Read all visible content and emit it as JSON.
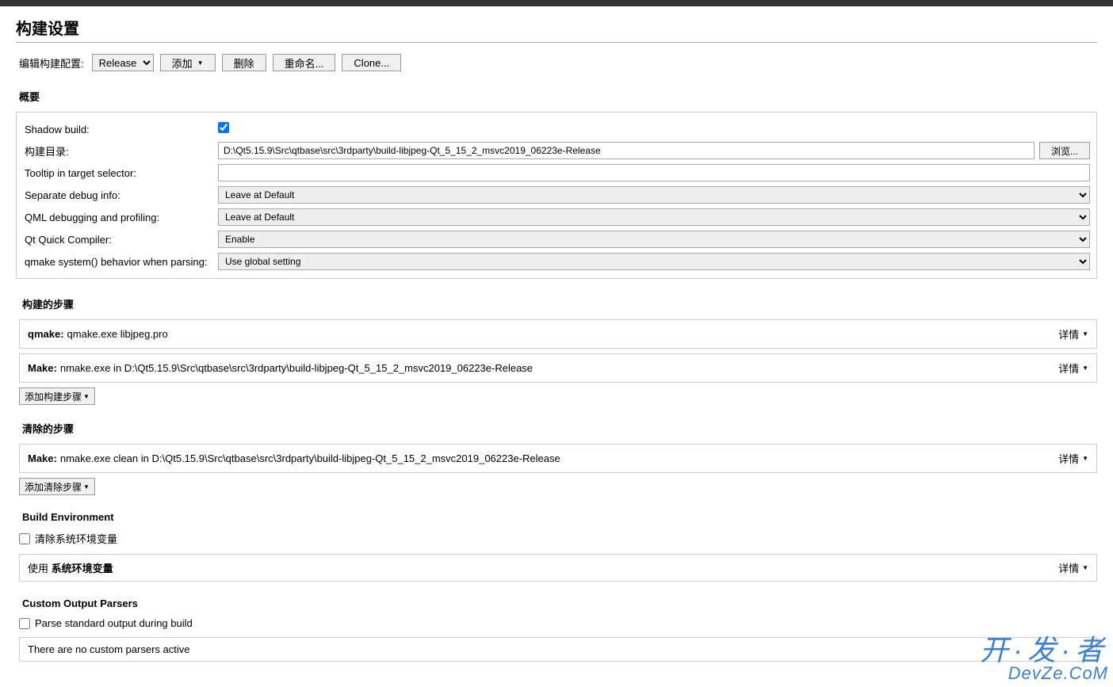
{
  "page": {
    "title": "构建设置"
  },
  "toolbar": {
    "config_label": "编辑构建配置:",
    "config_selected": "Release",
    "add_label": "添加",
    "delete_label": "删除",
    "rename_label": "重命名...",
    "clone_label": "Clone..."
  },
  "overview": {
    "heading": "概要",
    "shadow_build_label": "Shadow build:",
    "shadow_build_checked": true,
    "build_dir_label": "构建目录:",
    "build_dir_value": "D:\\Qt5.15.9\\Src\\qtbase\\src\\3rdparty\\build-libjpeg-Qt_5_15_2_msvc2019_06223e-Release",
    "browse_label": "浏览...",
    "tooltip_label": "Tooltip in target selector:",
    "tooltip_value": "",
    "debug_info_label": "Separate debug info:",
    "debug_info_value": "Leave at Default",
    "qml_debug_label": "QML debugging and profiling:",
    "qml_debug_value": "Leave at Default",
    "qt_quick_compiler_label": "Qt Quick Compiler:",
    "qt_quick_compiler_value": "Enable",
    "qmake_system_label": "qmake system() behavior when parsing:",
    "qmake_system_value": "Use global setting"
  },
  "build_steps": {
    "heading": "构建的步骤",
    "steps": [
      {
        "name": "qmake:",
        "value": "qmake.exe libjpeg.pro"
      },
      {
        "name": "Make:",
        "value": "nmake.exe in D:\\Qt5.15.9\\Src\\qtbase\\src\\3rdparty\\build-libjpeg-Qt_5_15_2_msvc2019_06223e-Release"
      }
    ],
    "details_label": "详情",
    "add_step_label": "添加构建步骤"
  },
  "clean_steps": {
    "heading": "清除的步骤",
    "steps": [
      {
        "name": "Make:",
        "value": "nmake.exe clean in D:\\Qt5.15.9\\Src\\qtbase\\src\\3rdparty\\build-libjpeg-Qt_5_15_2_msvc2019_06223e-Release"
      }
    ],
    "details_label": "详情",
    "add_step_label": "添加清除步骤"
  },
  "build_env": {
    "heading": "Build Environment",
    "clear_sys_label": "清除系统环境变量",
    "clear_sys_checked": false,
    "use_prefix": "使用 ",
    "use_bold": "系统环境变量",
    "details_label": "详情"
  },
  "custom_parsers": {
    "heading": "Custom Output Parsers",
    "parse_stdout_label": "Parse standard output during build",
    "parse_stdout_checked": false,
    "none_text": "There are no custom parsers active"
  },
  "watermark": {
    "line1": "开·发·者",
    "line2": "DevZe.CoM"
  }
}
